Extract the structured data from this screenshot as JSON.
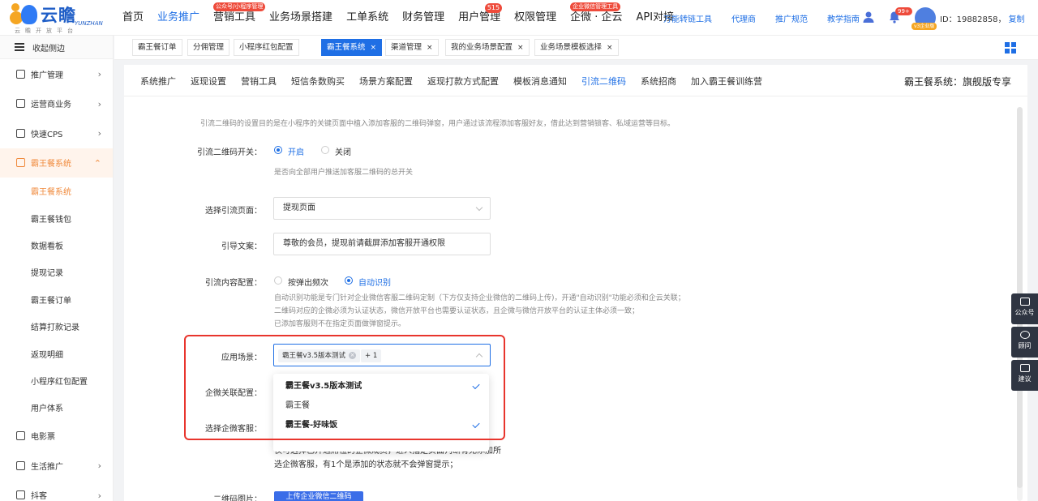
{
  "logo": {
    "title": "云瞻",
    "en": "YUNZHAN",
    "sub": "云瞻开放平台"
  },
  "mainnav": [
    {
      "label": "首页",
      "active": false,
      "tag": "",
      "count": ""
    },
    {
      "label": "业务推广",
      "active": true,
      "tag": "",
      "count": ""
    },
    {
      "label": "营销工具",
      "active": false,
      "tag": "公众号/小程序管理",
      "count": ""
    },
    {
      "label": "业务场景搭建",
      "active": false,
      "tag": "",
      "count": ""
    },
    {
      "label": "工单系统",
      "active": false,
      "tag": "",
      "count": ""
    },
    {
      "label": "财务管理",
      "active": false,
      "tag": "",
      "count": ""
    },
    {
      "label": "用户管理",
      "active": false,
      "tag": "",
      "count": "515"
    },
    {
      "label": "权限管理",
      "active": false,
      "tag": "",
      "count": ""
    },
    {
      "label": "企微 · 企云",
      "active": false,
      "tag": "企业微信管理工具",
      "count": ""
    },
    {
      "label": "API对接",
      "active": false,
      "tag": "",
      "count": ""
    }
  ],
  "subnav": [
    "万能转链工具",
    "代理商",
    "推广规范",
    "教学指南"
  ],
  "user": {
    "badge": "99+",
    "version": "v3企业版",
    "id_text": "ID：19882858，",
    "copy": "复制"
  },
  "sidebar": {
    "collapse": "收起侧边",
    "items": [
      {
        "label": "推广管理",
        "chevron": "›"
      },
      {
        "label": "运营商业务",
        "chevron": "›"
      },
      {
        "label": "快速CPS",
        "chevron": "›"
      },
      {
        "label": "霸王餐系统",
        "chevron": "⌃"
      }
    ],
    "subitems": [
      "霸王餐系统",
      "霸王餐钱包",
      "数据看板",
      "提现记录",
      "霸王餐订单",
      "结算打款记录",
      "返现明细",
      "小程序红包配置",
      "用户体系"
    ],
    "items_bottom": [
      {
        "label": "电影票",
        "chevron": ""
      },
      {
        "label": "生活推广",
        "chevron": "›"
      },
      {
        "label": "抖客",
        "chevron": "›"
      }
    ]
  },
  "tabs": [
    {
      "label": "霸王餐订单",
      "closable": false,
      "active": false
    },
    {
      "label": "分佣管理",
      "closable": false,
      "active": false
    },
    {
      "label": "小程序红包配置",
      "closable": false,
      "active": false
    },
    {
      "label": "霸王餐系统",
      "closable": true,
      "active": true
    },
    {
      "label": "渠道管理",
      "closable": true,
      "active": false
    },
    {
      "label": "我的业务场景配置",
      "closable": true,
      "active": false
    },
    {
      "label": "业务场景模板选择",
      "closable": true,
      "active": false
    }
  ],
  "content_tabs": [
    "系统推广",
    "返现设置",
    "营销工具",
    "短信条数购买",
    "场景方案配置",
    "返现打款方式配置",
    "模板消息通知",
    "引流二维码",
    "系统招商",
    "加入霸王餐训练营"
  ],
  "content_active_tab": "引流二维码",
  "edition": "霸王餐系统：旗舰版专享",
  "form": {
    "intro": "引流二维码的设置目的是在小程序的关键页面中植入添加客服的二维码弹窗，用户通过该流程添加客服好友，借此达到营销锁客、私域运营等目标。",
    "switch": {
      "label": "引流二维码开关：",
      "on": "开启",
      "off": "关闭",
      "hint": "是否向全部用户推送加客服二维码的总开关"
    },
    "page": {
      "label": "选择引流页面：",
      "value": "提现页面"
    },
    "copy": {
      "label": "引导文案：",
      "value": "尊敬的会员，提现前请截屏添加客服开通权限"
    },
    "content": {
      "label": "引流内容配置：",
      "opt1": "按弹出频次",
      "opt2": "自动识别",
      "hint1": "自动识别功能是专门针对企业微信客服二维码定制（下方仅支持企业微信的二维码上传)，开通\"自动识别\"功能必须和企云关联；",
      "hint2": "二维码对应的企微必须为认证状态，微信开放平台也需要认证状态，且企微与微信开放平台的认证主体必须一致；",
      "hint3": "已添加客服则不在指定页面做弹窗提示。"
    },
    "scene": {
      "label": "应用场景：",
      "chip": "霸王餐v3.5版本测试",
      "more": "+ 1"
    },
    "qiwei_link": {
      "label": "企微关联配置："
    },
    "qiwei_service": {
      "label": "选择企微客服："
    },
    "service_hint1": "仅可选择已开通席位的企微成员，进入指定页面判断有无添加所",
    "service_hint2": "选企微客服，有1个是添加的状态就不会弹窗提示；",
    "qrcode": {
      "label": "二维码图片：",
      "button": "上传企业微信二维码"
    }
  },
  "dropdown": [
    {
      "label": "霸王餐v3.5版本测试",
      "selected": true
    },
    {
      "label": "霸王餐",
      "selected": false
    },
    {
      "label": "霸王餐-好味饭",
      "selected": true
    }
  ],
  "float_panel": [
    "公众号",
    "顾问",
    "建议"
  ],
  "colors": {
    "accent": "#1f6fe5",
    "sidebar_active": "#f08a3c",
    "badge": "#ee4b3b",
    "highlight_box": "#e8352d"
  }
}
